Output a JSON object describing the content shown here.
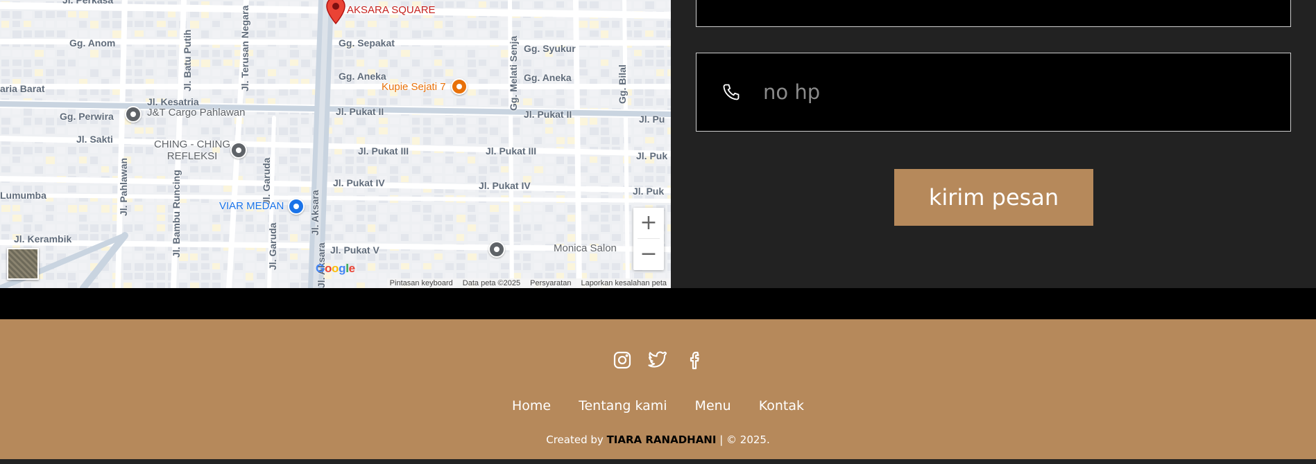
{
  "map": {
    "roads_horizontal": [
      {
        "label": "Jl. Perkasa"
      },
      {
        "label": "Gg. Anom"
      },
      {
        "label": "Gg. Sepakat"
      },
      {
        "label": "Gg. Syukur"
      },
      {
        "label": "Gg. Aneka"
      },
      {
        "label": "Gg. Aneka"
      },
      {
        "label": "aria Barat"
      },
      {
        "label": "Jl. Kesatria"
      },
      {
        "label": "Gg. Perwira"
      },
      {
        "label": "Jl. Pukat II"
      },
      {
        "label": "Jl. Pukat II"
      },
      {
        "label": "Jl. Pu"
      },
      {
        "label": "Jl. Sakti"
      },
      {
        "label": "Jl. Pukat III"
      },
      {
        "label": "Jl. Pukat III"
      },
      {
        "label": "Jl. Puk"
      },
      {
        "label": "Jl. Pukat IV"
      },
      {
        "label": "Jl. Pukat IV"
      },
      {
        "label": "Jl. Puk"
      },
      {
        "label": "Lumumba"
      },
      {
        "label": "Jl. Kerambik"
      },
      {
        "label": "Jl. Pukat V"
      }
    ],
    "roads_vertical": [
      {
        "label": "Jl. Batu Putih"
      },
      {
        "label": "Jl. Terusan Negara"
      },
      {
        "label": "Gg. Melati Senja"
      },
      {
        "label": "Gg. Bilal"
      },
      {
        "label": "Jl. Pahlawan"
      },
      {
        "label": "Jl. Bambu Runcing"
      },
      {
        "label": "Jl. Garuda"
      },
      {
        "label": "Jl. Garuda"
      },
      {
        "label": "Jl. Aksara"
      },
      {
        "label": "Jl. Aksara"
      }
    ],
    "places": [
      {
        "label": "AKSARA SQUARE",
        "color": "#c5221f"
      },
      {
        "label": "Kupie Sejati 7",
        "color": "#e8710a"
      },
      {
        "label": "J&T Cargo Pahlawan",
        "color": "#5f6368"
      },
      {
        "label": "CHING - CHING\nREFLEKSI",
        "color": "#5f6368"
      },
      {
        "label": "VIAR MEDAN",
        "color": "#1a73e8"
      },
      {
        "label": "Monica Salon",
        "color": "#5f6368"
      }
    ],
    "zoom_in": "+",
    "zoom_out": "−",
    "google_logo": [
      "G",
      "o",
      "o",
      "g",
      "l",
      "e"
    ],
    "footer_links": [
      "Pintasan keyboard",
      "Data peta ©2025",
      "Persyaratan",
      "Laporkan kesalahan peta"
    ]
  },
  "form": {
    "phone_placeholder": "no hp",
    "phone_value": "",
    "submit_label": "kirim pesan"
  },
  "footer": {
    "socials": [
      "instagram-icon",
      "twitter-icon",
      "facebook-icon"
    ],
    "nav": [
      "Home",
      "Tentang kami",
      "Menu",
      "Kontak"
    ],
    "credit_prefix": "Created by ",
    "credit_name": "TIARA RANADHANI",
    "credit_suffix": " | © 2025."
  },
  "colors": {
    "accent": "#b6895b",
    "panel": "#222222",
    "page": "#000000"
  }
}
